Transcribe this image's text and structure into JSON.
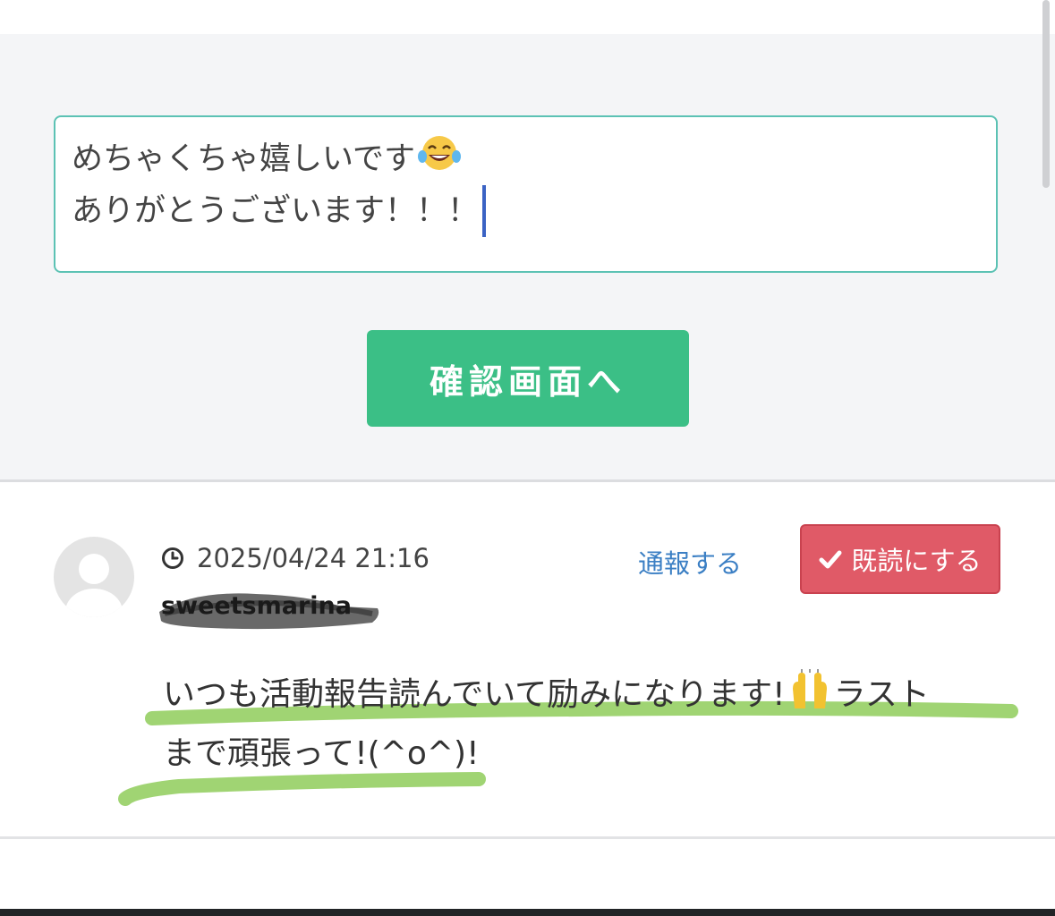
{
  "reply_form": {
    "text_line1": "めちゃくちゃ嬉しいです",
    "text_line2": "ありがとうございます！！！",
    "submit_label": "確認画面へ"
  },
  "comment": {
    "timestamp": "2025/04/24 21:16",
    "username": "sweetsmarina",
    "report_label": "通報する",
    "mark_read_label": "既読にする",
    "body_line1_part1": "いつも活動報告読んでいて励みになります!",
    "body_line1_part2": "ラスト",
    "body_line2": "まで頑張って!(^o^)!"
  },
  "colors": {
    "accent_green": "#3bbf86",
    "textarea_border": "#5cc2b4",
    "link_blue": "#3b7fc4",
    "read_button": "#e05a67",
    "highlight": "#8fcc5a"
  },
  "icons": [
    "laughing-tears-emoji-icon",
    "clock-icon",
    "check-icon",
    "raised-hands-emoji-icon",
    "default-avatar-icon"
  ]
}
